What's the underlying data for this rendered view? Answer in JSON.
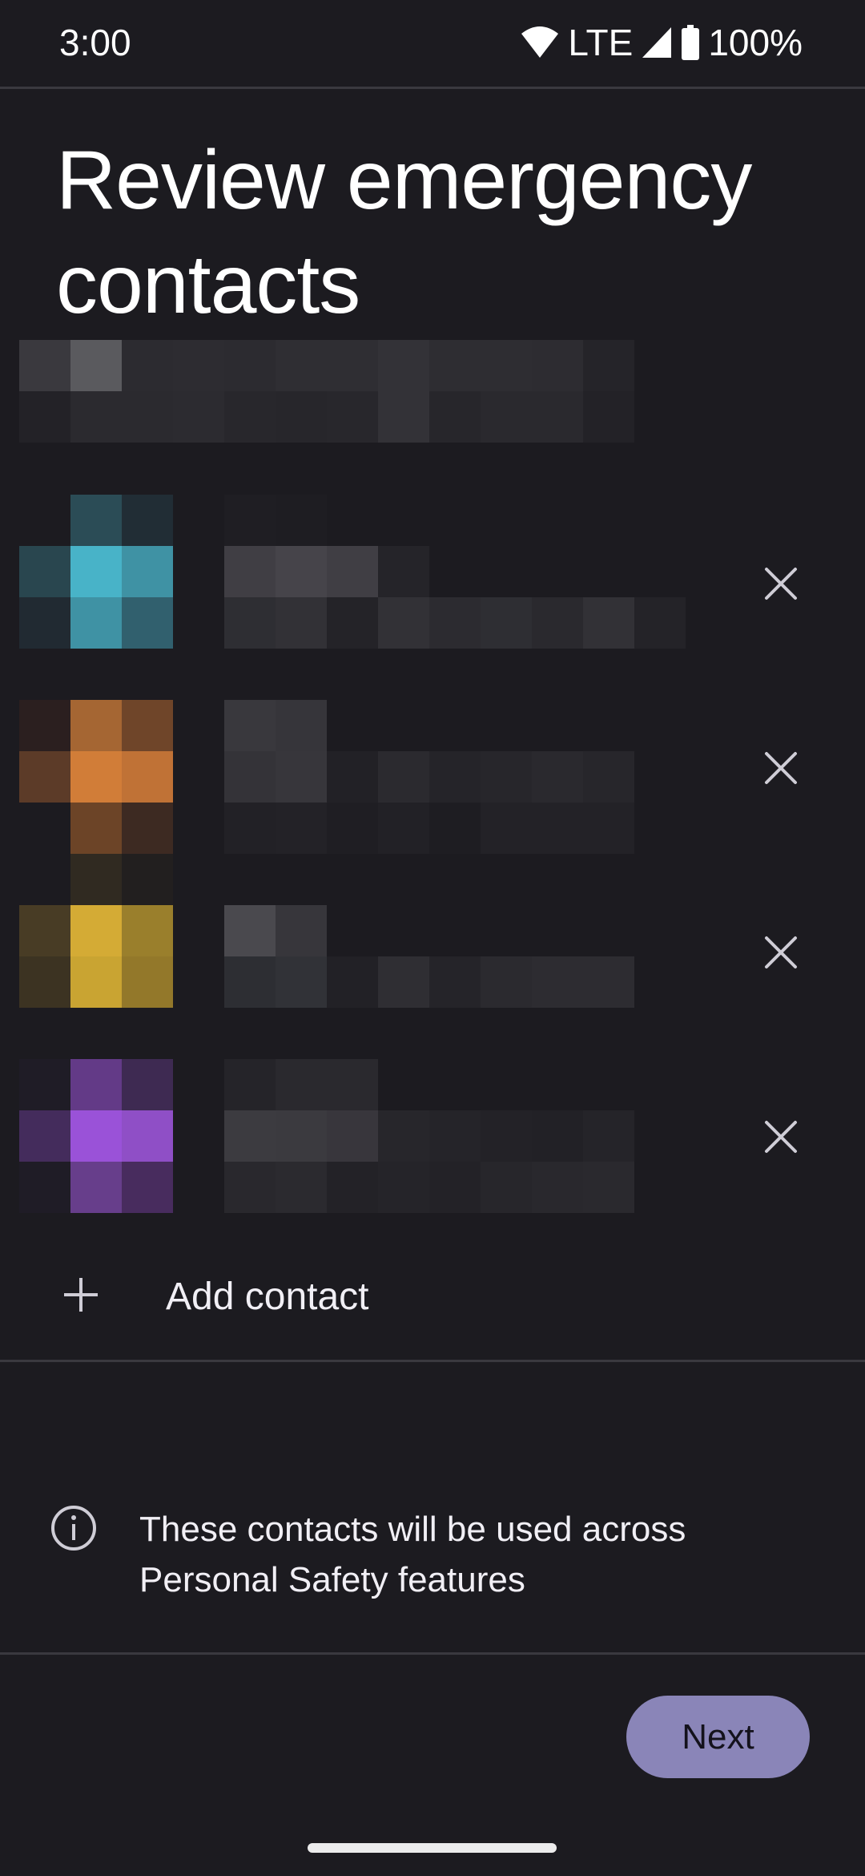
{
  "status_bar": {
    "time": "3:00",
    "network": "LTE",
    "battery": "100%",
    "icons": [
      "wifi-icon",
      "cell-signal-icon",
      "battery-icon"
    ]
  },
  "header": {
    "title": "Review emergency contacts"
  },
  "redacted_header_mosaic": {
    "note": "pixelated/redacted content",
    "rows": [
      [
        "#3a393e",
        "#5a5a5e",
        "#2c2b30",
        "#2d2c31",
        "#2c2b30",
        "#2f2e33",
        "#2f2e33",
        "#333237",
        "#2e2d32",
        "#2e2d32",
        "#2d2c31",
        "#252429"
      ],
      [
        "#232227",
        "#2b2a2f",
        "#2b2a2f",
        "#2c2b30",
        "#28272c",
        "#27262b",
        "#28272c",
        "#333237",
        "#27262b",
        "#2a292e",
        "#2a292e",
        "#232227"
      ]
    ]
  },
  "contacts": [
    {
      "redacted": true,
      "avatar_color": "#48b3c8",
      "avatar_rows": [
        [
          null,
          "#2b4c56",
          "#212d35"
        ],
        [
          "#29464f",
          "#48b3c8",
          "#3f92a4"
        ],
        [
          "#212a32",
          "#3f92a4",
          "#31606e"
        ]
      ],
      "text_rows": [
        [
          "#1f1e23",
          "#1e1d22",
          null,
          null,
          null,
          null,
          null,
          null,
          null
        ],
        [
          "#403e44",
          "#46444a",
          "#403e44",
          "#252429",
          null,
          null,
          null,
          null,
          null
        ],
        [
          "#2e2e33",
          "#323136",
          "#242328",
          "#323136",
          "#2c2b30",
          "#2e2e33",
          "#2a292e",
          "#323136",
          "#242328"
        ]
      ],
      "remove_icon": "close-icon"
    },
    {
      "redacted": true,
      "avatar_color": "#d17d38",
      "avatar_rows": [
        [
          "#2b1f1f",
          "#a56633",
          "#6f4529"
        ],
        [
          "#5c3b28",
          "#d17d38",
          "#c07236"
        ],
        [
          null,
          "#6c4427",
          "#3d2a22"
        ],
        [
          null,
          "#302a21",
          "#221f1f"
        ]
      ],
      "text_rows": [
        [
          "#39383d",
          "#36353a",
          null,
          null,
          null,
          null,
          null,
          null
        ],
        [
          "#343338",
          "#37363b",
          "#222126",
          "#2b2a2f",
          "#252429",
          "#27262b",
          "#2a292e",
          "#27262b"
        ],
        [
          "#222126",
          "#232227",
          "#1f1e23",
          "#222126",
          "#1e1d22",
          "#232227",
          "#232227",
          "#232227"
        ]
      ],
      "remove_icon": "close-icon"
    },
    {
      "redacted": true,
      "avatar_color": "#d4ab35",
      "avatar_rows": [
        [
          "#483c25",
          "#d4ab35",
          "#9a7f2c"
        ],
        [
          "#3c3322",
          "#c9a432",
          "#93782a"
        ]
      ],
      "text_rows": [
        [
          "#4a494e",
          "#37363b",
          null,
          null,
          null,
          null,
          null,
          null
        ],
        [
          "#2d2e33",
          "#313237",
          "#222126",
          "#2f2e33",
          "#252429",
          "#2b2a2f",
          "#2d2c31",
          "#2d2c31"
        ]
      ],
      "remove_icon": "close-icon"
    },
    {
      "redacted": true,
      "avatar_color": "#9a52d8",
      "avatar_rows": [
        [
          "#1f1c26",
          "#633a87",
          "#3e2a52"
        ],
        [
          "#442c5c",
          "#9a52d8",
          "#8f4fc6"
        ],
        [
          "#1f1c26",
          "#673e8b",
          "#482c5e"
        ]
      ],
      "text_rows": [
        [
          "#252429",
          "#2a292e",
          "#2a292e",
          null,
          null,
          null,
          null,
          null
        ],
        [
          "#3c3b40",
          "#3b3a3f",
          "#38363c",
          "#27262b",
          "#252429",
          "#232227",
          "#222126",
          "#252429"
        ],
        [
          "#29282d",
          "#2b2a2f",
          "#232227",
          "#252429",
          "#232227",
          "#27262b",
          "#29282d",
          "#2a292e"
        ]
      ],
      "remove_icon": "close-icon"
    }
  ],
  "add_contact": {
    "icon": "plus-icon",
    "label": "Add contact"
  },
  "info": {
    "icon": "info-icon",
    "text": "These contacts will be used across Personal Safety features"
  },
  "footer": {
    "next_label": "Next",
    "next_color": "#8a85b8"
  },
  "colors": {
    "background": "#1c1b20",
    "divider": "#3a393f",
    "icon": "#cfcdd6",
    "accent": "#8a85b8"
  }
}
